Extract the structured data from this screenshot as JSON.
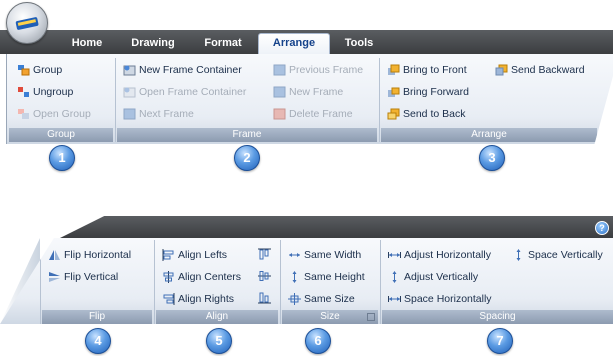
{
  "top_ribbon": {
    "tabs": [
      "Home",
      "Drawing",
      "Format",
      "Arrange",
      "Tools"
    ],
    "active_tab": "Arrange",
    "groups": {
      "group": {
        "label": "Group",
        "items": [
          {
            "label": "Group",
            "enabled": true,
            "icon": "group-icon"
          },
          {
            "label": "Ungroup",
            "enabled": true,
            "icon": "ungroup-icon"
          },
          {
            "label": "Open Group",
            "enabled": false,
            "icon": "open-group-icon"
          }
        ]
      },
      "frame": {
        "label": "Frame",
        "items": [
          {
            "label": "New Frame Container",
            "enabled": true,
            "icon": "new-frame-container-icon"
          },
          {
            "label": "Open Frame Container",
            "enabled": false,
            "icon": "open-frame-container-icon"
          },
          {
            "label": "Next Frame",
            "enabled": false,
            "icon": "next-frame-icon"
          },
          {
            "label": "Previous Frame",
            "enabled": false,
            "icon": "previous-frame-icon"
          },
          {
            "label": "New Frame",
            "enabled": false,
            "icon": "new-frame-icon"
          },
          {
            "label": "Delete Frame",
            "enabled": false,
            "icon": "delete-frame-icon"
          }
        ]
      },
      "arrange": {
        "label": "Arrange",
        "items": [
          {
            "label": "Bring to Front",
            "enabled": true,
            "icon": "bring-to-front-icon"
          },
          {
            "label": "Send Backward",
            "enabled": true,
            "icon": "send-backward-icon"
          },
          {
            "label": "Bring Forward",
            "enabled": true,
            "icon": "bring-forward-icon"
          },
          {
            "label": "Send to Back",
            "enabled": true,
            "icon": "send-to-back-icon"
          }
        ]
      }
    },
    "callouts": [
      "1",
      "2",
      "3"
    ]
  },
  "bottom_ribbon": {
    "groups": {
      "flip": {
        "label": "Flip",
        "items": [
          {
            "label": "Flip Horizontal",
            "icon": "flip-horizontal-icon"
          },
          {
            "label": "Flip Vertical",
            "icon": "flip-vertical-icon"
          }
        ]
      },
      "align": {
        "label": "Align",
        "items": [
          {
            "label": "Align Lefts",
            "icon": "align-lefts-icon"
          },
          {
            "label": "Align Centers",
            "icon": "align-centers-icon"
          },
          {
            "label": "Align Rights",
            "icon": "align-rights-icon"
          }
        ]
      },
      "size": {
        "label": "Size",
        "items": [
          {
            "label": "Same Width",
            "icon": "same-width-icon"
          },
          {
            "label": "Same Height",
            "icon": "same-height-icon"
          },
          {
            "label": "Same Size",
            "icon": "same-size-icon"
          }
        ]
      },
      "spacing": {
        "label": "Spacing",
        "items": [
          {
            "label": "Adjust Horizontally",
            "icon": "adjust-horizontally-icon"
          },
          {
            "label": "Space Vertically",
            "icon": "space-vertically-icon"
          },
          {
            "label": "Adjust Vertically",
            "icon": "adjust-vertically-icon"
          },
          {
            "label": "Space Horizontally",
            "icon": "space-horizontally-icon"
          }
        ]
      }
    },
    "help_glyph": "?",
    "callouts": [
      "4",
      "5",
      "6",
      "7"
    ]
  }
}
